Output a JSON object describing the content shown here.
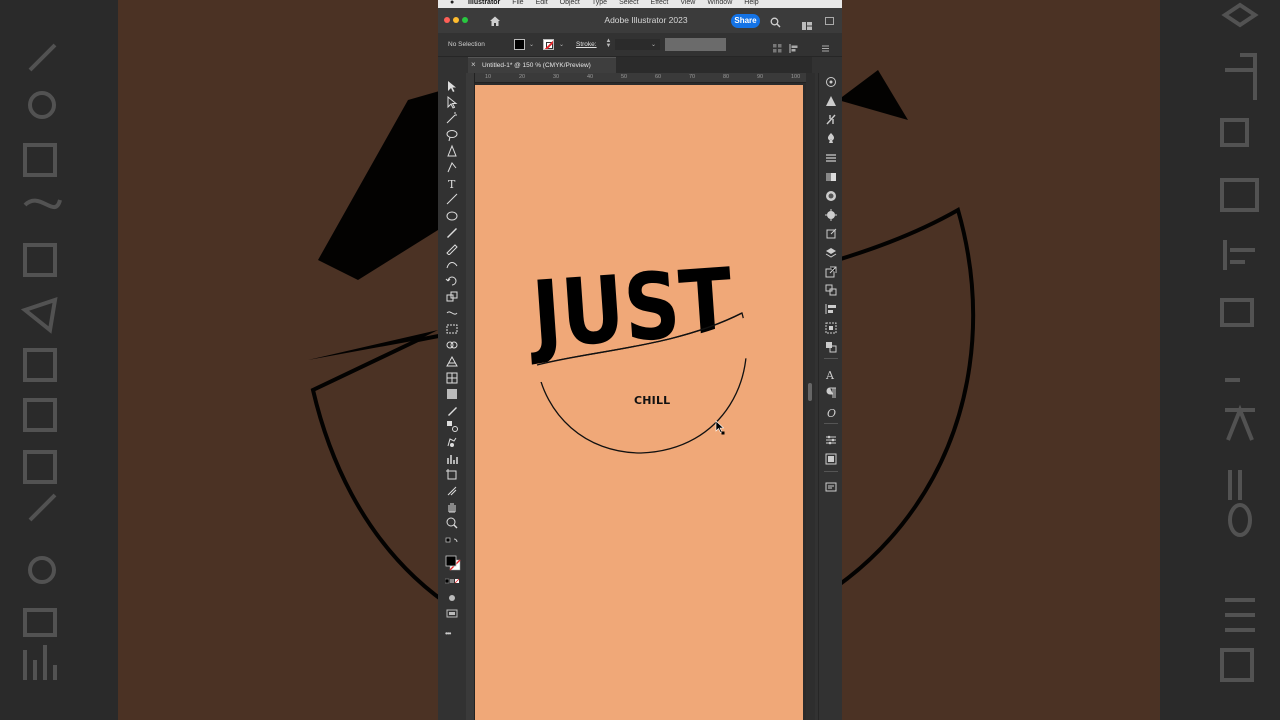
{
  "menubar": {
    "items": [
      "Illustrator",
      "File",
      "Edit",
      "Object",
      "Type",
      "Select",
      "Effect",
      "View",
      "Window",
      "Help"
    ]
  },
  "window": {
    "title": "Adobe Illustrator 2023",
    "share_label": "Share"
  },
  "control_bar": {
    "selection_status": "No Selection",
    "stroke_label": "Stroke:"
  },
  "document": {
    "tab_title": "Untitled-1* @ 150 % (CMYK/Preview)",
    "close_glyph": "×"
  },
  "ruler": {
    "top_labels": [
      "10",
      "20",
      "30",
      "40",
      "50",
      "60",
      "70",
      "80",
      "90",
      "100"
    ]
  },
  "artwork": {
    "headline": "JUST",
    "subtext": "CHILL",
    "artboard_color": "#f0a878"
  },
  "toolbar": {
    "tools": [
      "selection-tool",
      "direct-selection-tool",
      "magic-wand-tool",
      "lasso-tool",
      "pen-tool",
      "curvature-tool",
      "type-tool",
      "line-segment-tool",
      "ellipse-tool",
      "paintbrush-tool",
      "pencil-tool",
      "shaper-tool",
      "rotate-tool",
      "scale-tool",
      "width-tool",
      "free-transform-tool",
      "shape-builder-tool",
      "perspective-grid-tool",
      "mesh-tool",
      "gradient-tool",
      "eyedropper-tool",
      "blend-tool",
      "symbol-sprayer-tool",
      "column-graph-tool",
      "artboard-tool",
      "slice-tool",
      "hand-tool",
      "zoom-tool"
    ],
    "more_glyph": "•••"
  },
  "colors": {
    "share_blue": "#1473e6",
    "background_brown": "#4b3224"
  }
}
